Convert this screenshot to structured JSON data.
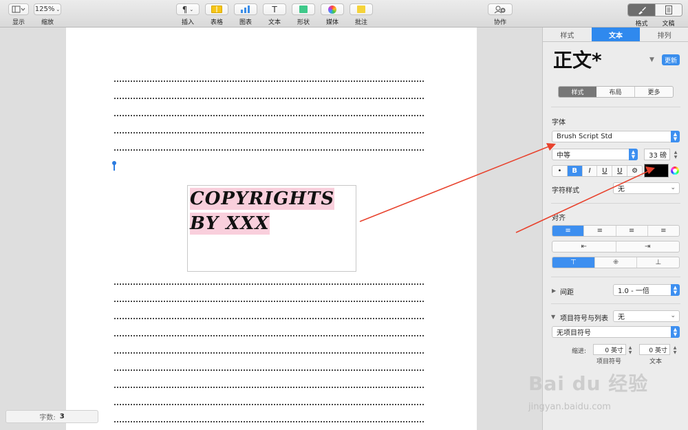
{
  "toolbar": {
    "display_label": "显示",
    "zoom_value": "125%",
    "zoom_label": "缩放",
    "insert_label": "插入",
    "table_label": "表格",
    "chart_label": "图表",
    "text_label": "文本",
    "shape_label": "形状",
    "media_label": "媒体",
    "comment_label": "批注",
    "collab_label": "协作",
    "format_label": "格式",
    "document_label": "文稿",
    "insert_glyph": "¶",
    "text_glyph": "T"
  },
  "document": {
    "textbox_lines": [
      "COPYRIGHTS",
      "BY XXX"
    ],
    "word_count_label": "字数:",
    "word_count_value": "3"
  },
  "inspector": {
    "tabs": [
      "样式",
      "文本",
      "排列"
    ],
    "style_name": "正文*",
    "update_label": "更新",
    "subtabs": [
      "样式",
      "布局",
      "更多"
    ],
    "font_section": "字体",
    "font_family": "Brush Script Std",
    "font_weight": "中等",
    "font_size": "33 磅",
    "format_buttons": [
      "•",
      "B",
      "I",
      "U",
      "U",
      "⚙"
    ],
    "char_style_label": "字符样式",
    "char_style_value": "无",
    "align_section": "对齐",
    "align_glyphs": [
      "≡",
      "≡",
      "≡",
      "≡"
    ],
    "indent_glyphs": [
      "⇤",
      "⇥"
    ],
    "valign_glyphs": [
      "⊤",
      "⁜",
      "⊥"
    ],
    "spacing_label": "间距",
    "spacing_value": "1.0 - 一倍",
    "bullets_label": "项目符号与列表",
    "bullets_value": "无",
    "bullet_type": "无项目符号",
    "indent_label": "缩进:",
    "indent_bullet_value": "0 英寸",
    "indent_text_value": "0 英寸",
    "indent_bullet_caption": "项目符号",
    "indent_text_caption": "文本"
  },
  "watermark": {
    "brand": "Bai du 经验",
    "url": "jingyan.baidu.com"
  },
  "colors": {
    "accent": "#2f89ee",
    "highlight": "#f9cfdc",
    "annotation_arrow": "#e8432e"
  }
}
